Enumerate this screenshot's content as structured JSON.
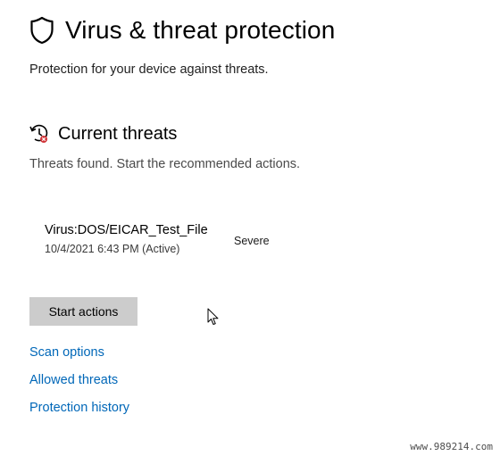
{
  "header": {
    "title": "Virus & threat protection",
    "subtitle": "Protection for your device against threats.",
    "icon": "shield-icon"
  },
  "current_threats": {
    "title": "Current threats",
    "description": "Threats found. Start the recommended actions.",
    "icon": "threat-clock-icon",
    "items": [
      {
        "name": "Virus:DOS/EICAR_Test_File",
        "time": "10/4/2021 6:43 PM (Active)",
        "severity": "Severe"
      }
    ]
  },
  "actions": {
    "start_label": "Start actions"
  },
  "links": {
    "scan_options": "Scan options",
    "allowed_threats": "Allowed threats",
    "protection_history": "Protection history"
  },
  "colors": {
    "link": "#0067b8",
    "button_bg": "#cccccc",
    "alert": "#d13438"
  },
  "watermark": "www.989214.com"
}
